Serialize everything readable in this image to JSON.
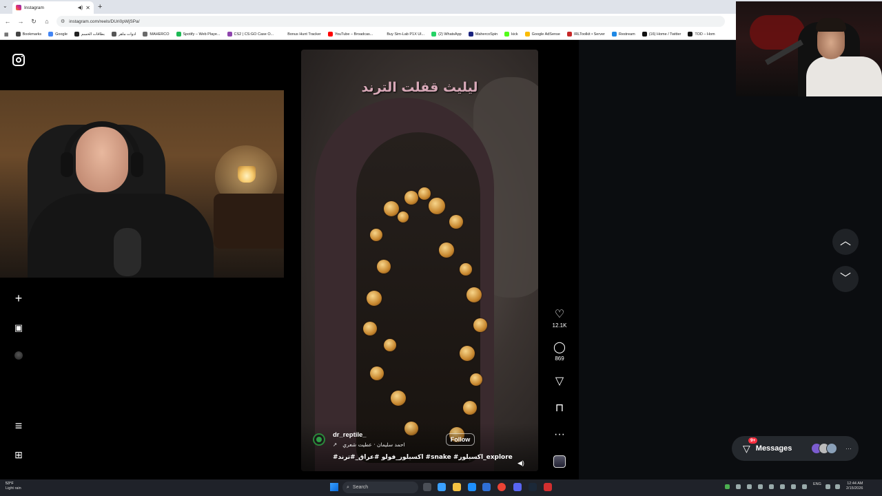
{
  "browser": {
    "tab_title": "Instagram",
    "url": "instagram.com/reels/DUri0pWjSPa/",
    "bookmarks": [
      {
        "label": "Bookmarks",
        "color": "#444444"
      },
      {
        "label": "Google",
        "color": "#4285f4"
      },
      {
        "label": "بطاقات الحسم",
        "color": "#222222"
      },
      {
        "label": "ادوات ماهر",
        "color": "#555555"
      },
      {
        "label": "MAHERCO",
        "color": "#6a6a6a"
      },
      {
        "label": "Spotify – Web Playe...",
        "color": "#1db954"
      },
      {
        "label": "CS2 | CS:GO Case O...",
        "color": "#8e44ad"
      },
      {
        "label": "Bonus Hunt Tracker",
        "color": "#ffffff"
      },
      {
        "label": "YouTube – Broadcas...",
        "color": "#ff0000"
      },
      {
        "label": "Buy Sim-Lab P1X Ul...",
        "color": "#ffffff"
      },
      {
        "label": "(2) WhatsApp",
        "color": "#25d366"
      },
      {
        "label": "MahercoSpin",
        "color": "#1a237e"
      },
      {
        "label": "kick",
        "color": "#53fc18"
      },
      {
        "label": "Google AdSense",
        "color": "#fbbc04"
      },
      {
        "label": "IRLToolkit • Server",
        "color": "#c62828"
      },
      {
        "label": "Restream",
        "color": "#1e88e5"
      },
      {
        "label": "(16) Home / Twitter",
        "color": "#111111"
      },
      {
        "label": "TOD – Hom",
        "color": "#111111"
      }
    ]
  },
  "reel": {
    "overlay_text": "ليليث قفلت الترند",
    "author": "dr_reptile_",
    "audio": "احمد سليمان · عطيت شعري",
    "follow_label": "Follow",
    "hashtags": "#اكسبلور_فولو #عراق_#ترند #snake #اكسبلور_explore"
  },
  "actions": {
    "likes": "12.1K",
    "comments": "869"
  },
  "messages": {
    "label": "Messages",
    "badge": "9+"
  },
  "taskbar": {
    "weather_temp": "53°F",
    "weather_desc": "Light rain",
    "search_placeholder": "Search",
    "lang": "ENG",
    "time": "12:44 AM",
    "date": "2/15/2026"
  },
  "icons": {
    "like": "heart-icon",
    "comment": "comment-icon",
    "share": "send-icon",
    "save": "bookmark-icon",
    "more": "more-icon"
  },
  "colors": {
    "badge": "#ff3040",
    "page_bg": "#000000"
  }
}
